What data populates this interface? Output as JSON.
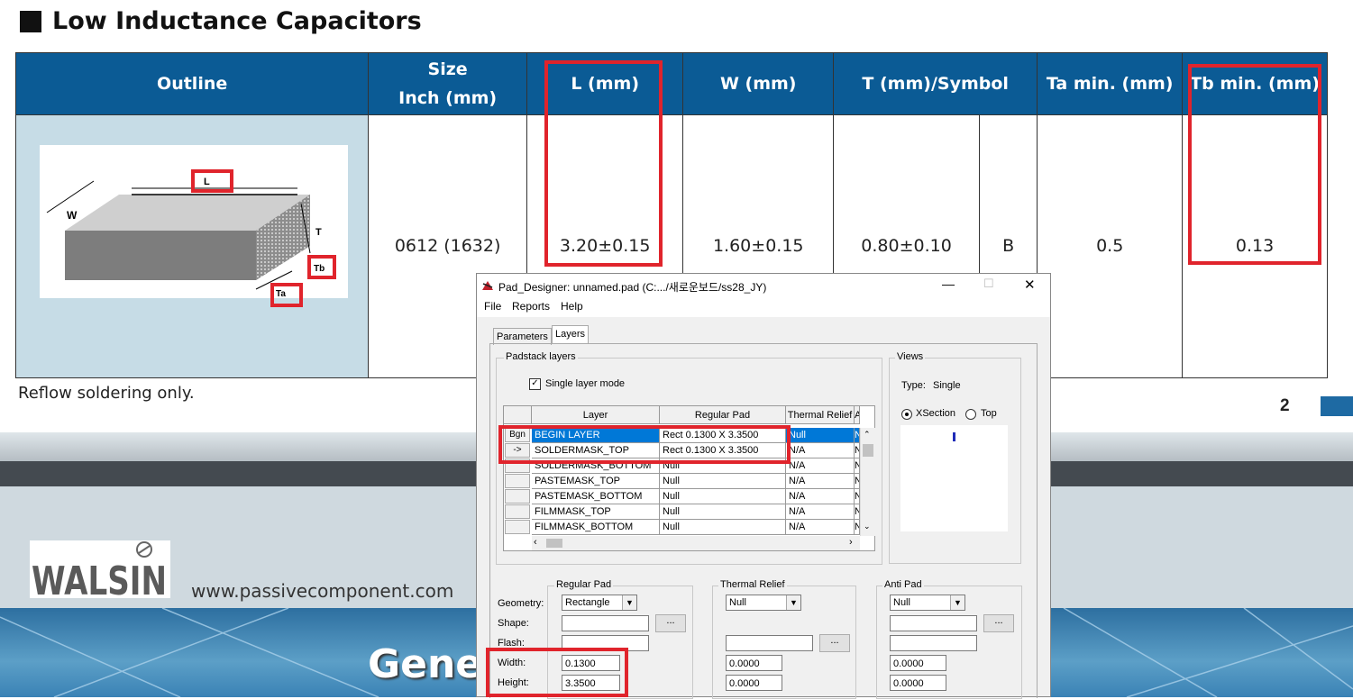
{
  "document": {
    "title": "Low Inductance Capacitors",
    "table": {
      "headers": [
        "Outline",
        "Size\nInch (mm)",
        "L (mm)",
        "W (mm)",
        "T (mm)/Symbol",
        "Ta min. (mm)",
        "Tb  min. (mm)"
      ],
      "row": {
        "size": "0612 (1632)",
        "l": "3.20±0.15",
        "w": "1.60±0.15",
        "t": "0.80±0.10",
        "symbol": "B",
        "ta": "0.5",
        "tb": "0.13"
      },
      "drawing_labels": {
        "l": "L",
        "w": "W",
        "t": "T",
        "tb": "Tb",
        "ta": "Ta"
      }
    },
    "note": "Reflow soldering only.",
    "page_number": "2",
    "logo_text": "WALSIN",
    "website": "www.passivecomponent.com",
    "footer_heading": "Gene"
  },
  "window": {
    "title": "Pad_Designer: unnamed.pad (C:.../새로운보드/ss28_JY)",
    "controls": {
      "minimize": "—",
      "maximize": "☐",
      "close": "✕"
    },
    "menu": [
      "File",
      "Reports",
      "Help"
    ],
    "tabs": [
      "Parameters",
      "Layers"
    ],
    "active_tab": "Layers",
    "padstack": {
      "group_label": "Padstack layers",
      "single_layer_mode": "Single layer mode",
      "single_layer_checked": true,
      "columns": [
        "Layer",
        "Regular Pad",
        "Thermal Relief",
        "A"
      ],
      "rows": [
        {
          "btn": "Bgn",
          "layer": "BEGIN LAYER",
          "regular": "Rect 0.1300 X 3.3500",
          "thermal": "Null",
          "anti": "N"
        },
        {
          "btn": "->",
          "layer": "SOLDERMASK_TOP",
          "regular": "Rect 0.1300 X 3.3500",
          "thermal": "N/A",
          "anti": "N"
        },
        {
          "btn": "",
          "layer": "SOLDERMASK_BOTTOM",
          "regular": "Null",
          "thermal": "N/A",
          "anti": "N"
        },
        {
          "btn": "",
          "layer": "PASTEMASK_TOP",
          "regular": "Null",
          "thermal": "N/A",
          "anti": "N"
        },
        {
          "btn": "",
          "layer": "PASTEMASK_BOTTOM",
          "regular": "Null",
          "thermal": "N/A",
          "anti": "N"
        },
        {
          "btn": "",
          "layer": "FILMMASK_TOP",
          "regular": "Null",
          "thermal": "N/A",
          "anti": "N"
        },
        {
          "btn": "",
          "layer": "FILMMASK_BOTTOM",
          "regular": "Null",
          "thermal": "N/A",
          "anti": "N"
        }
      ]
    },
    "views": {
      "group_label": "Views",
      "type_label": "Type:",
      "type_value": "Single",
      "xsection": "XSection",
      "top": "Top",
      "selected": "XSection"
    },
    "regular_pad": {
      "group_label": "Regular Pad",
      "geometry": "Rectangle",
      "shape": "",
      "flash": "",
      "width": "0.1300",
      "height": "3.3500"
    },
    "thermal_relief": {
      "group_label": "Thermal Relief",
      "geometry": "Null",
      "width": "0.0000",
      "height": "0.0000"
    },
    "anti_pad": {
      "group_label": "Anti Pad",
      "geometry": "Null",
      "width": "0.0000",
      "height": "0.0000"
    },
    "field_labels": {
      "geometry": "Geometry:",
      "shape": "Shape:",
      "flash": "Flash:",
      "width": "Width:",
      "height": "Height:"
    },
    "browse_label": "..."
  }
}
